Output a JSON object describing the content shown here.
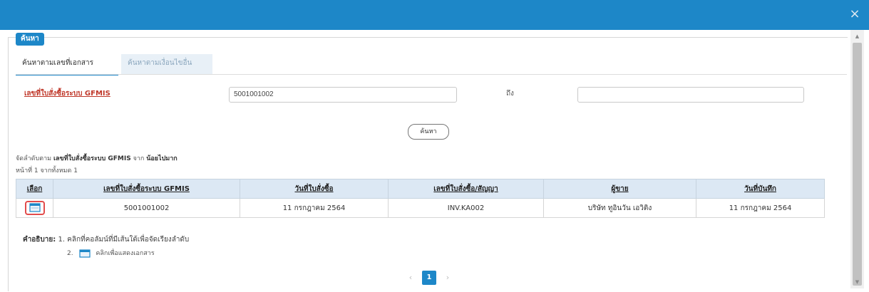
{
  "window": {
    "close_glyph": "×"
  },
  "search_section": {
    "legend": "ค้นหา",
    "tabs": [
      {
        "label": "ค้นหาตามเลขที่เอกสาร",
        "active": true
      },
      {
        "label": "ค้นหาตามเงื่อนไขอื่น",
        "active": false
      }
    ],
    "field_label": "เลขที่ใบสั่งซื้อระบบ GFMIS",
    "from_value": "5001001002",
    "to_label": "ถึง",
    "to_value": "",
    "search_button": "ค้นหา"
  },
  "results": {
    "sort_prefix": "จัดลำดับตาม",
    "sort_field": "เลขที่ใบสั่งซื้อระบบ GFMIS",
    "sort_mid": "จาก",
    "sort_order": "น้อยไปมาก",
    "page_info": "หน้าที่ 1 จากทั้งหมด 1",
    "columns": [
      "เลือก",
      "เลขที่ใบสั่งซื้อระบบ GFMIS",
      "วันที่ใบสั่งซื้อ",
      "เลขที่ใบสั่งซื้อ/สัญญา",
      "ผู้ขาย",
      "วันที่บันทึก"
    ],
    "rows": [
      {
        "po_number": "5001001002",
        "po_date": "11 กรกฎาคม 2564",
        "contract_no": "INV.KA002",
        "vendor": "บริษัท ทูอินวัน เอวิติง",
        "record_date": "11 กรกฎาคม 2564"
      }
    ]
  },
  "description": {
    "label": "คำอธิบาย:",
    "line1": "1. คลิกที่คอลัมน์ที่มีเส้นใต้เพื่อจัดเรียงลำดับ",
    "line2_num": "2.",
    "line2_text": "คลิกเพื่อแสดงเอกสาร"
  },
  "pagination": {
    "prev": "‹",
    "current": "1",
    "next": "›"
  },
  "colors": {
    "accent": "#1d87c8",
    "header_bg": "#dce8f4",
    "label_red": "#c0392b",
    "icon_highlight": "#e24c4c"
  },
  "icons": {
    "select_row": "document-icon",
    "close": "close-icon"
  }
}
